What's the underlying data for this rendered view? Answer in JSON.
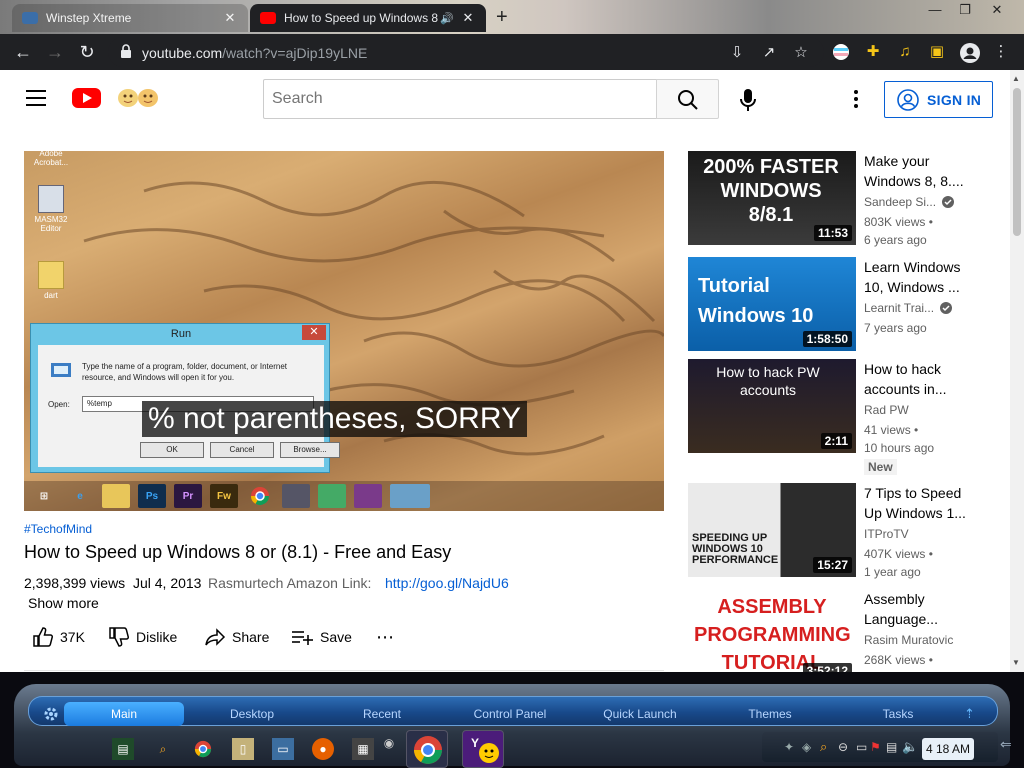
{
  "browser": {
    "tabs": [
      {
        "title": "Winstep Xtreme",
        "active": false
      },
      {
        "title": "How to Speed up Windows 8",
        "active": true
      }
    ],
    "url_host": "youtube.com",
    "url_path": "/watch?v=ajDip19yLNE"
  },
  "youtube": {
    "search_placeholder": "Search",
    "sign_in_label": "SIGN IN"
  },
  "video": {
    "hashtag": "#TechofMind",
    "title": "How to Speed up Windows 8 or (8.1) - Free and Easy",
    "views": "2,398,399 views",
    "date": "Jul 4, 2013",
    "description_preview": "Rasmurtech Amazon Link:",
    "description_link": "http://goo.gl/NajdU6",
    "show_more": "Show more",
    "likes": "37K",
    "dislike_label": "Dislike",
    "share_label": "Share",
    "save_label": "Save",
    "caption": "% not parentheses, SORRY",
    "frame": {
      "desktop_icons": [
        "Adobe Acrobat...",
        "MASM32 Editor",
        "dart"
      ],
      "run_dialog": {
        "title": "Run",
        "prompt": "Type the name of a program, folder, document, or Internet resource, and Windows will open it for you.",
        "open_label": "Open:",
        "open_value": "%temp",
        "ok": "OK",
        "cancel": "Cancel",
        "browse": "Browse..."
      }
    }
  },
  "sidebar": [
    {
      "title": "Make your Windows 8, 8....",
      "channel": "Sandeep Si...",
      "verified": true,
      "views": "803K views •",
      "age": "6 years ago",
      "duration": "11:53",
      "thumb_text": "200% FASTER WINDOWS 8/8.1"
    },
    {
      "title": "Learn Windows 10, Windows ...",
      "channel": "Learnit Trai...",
      "verified": true,
      "views": "",
      "age": "7 years ago",
      "duration": "1:58:50",
      "thumb_text": "Tutorial Windows 10"
    },
    {
      "title": "How to hack accounts in...",
      "channel": "Rad PW",
      "verified": false,
      "views": "41 views •",
      "age": "10 hours ago",
      "duration": "2:11",
      "badge": "New",
      "thumb_text": "How to hack PW accounts"
    },
    {
      "title": "7 Tips to Speed Up Windows 1...",
      "channel": "ITProTV",
      "verified": false,
      "views": "407K views •",
      "age": "1 year ago",
      "duration": "15:27",
      "thumb_text": "SPEEDING UP WINDOWS 10 PERFORMANCE"
    },
    {
      "title": "Assembly Language...",
      "channel": "Rasim Muratovic",
      "verified": false,
      "views": "268K views •",
      "age": "",
      "duration": "3:52:12",
      "thumb_text": "ASSEMBLY PROGRAMMING TUTORIAL"
    }
  ],
  "winstep": {
    "menu": [
      "Main",
      "Desktop",
      "Recent",
      "Control Panel",
      "Quick Launch",
      "Themes",
      "Tasks"
    ],
    "clock": "4 18 AM"
  },
  "colors": {
    "yt_red": "#ff0000",
    "link_blue": "#065fd4",
    "chrome_dark": "#202124"
  }
}
